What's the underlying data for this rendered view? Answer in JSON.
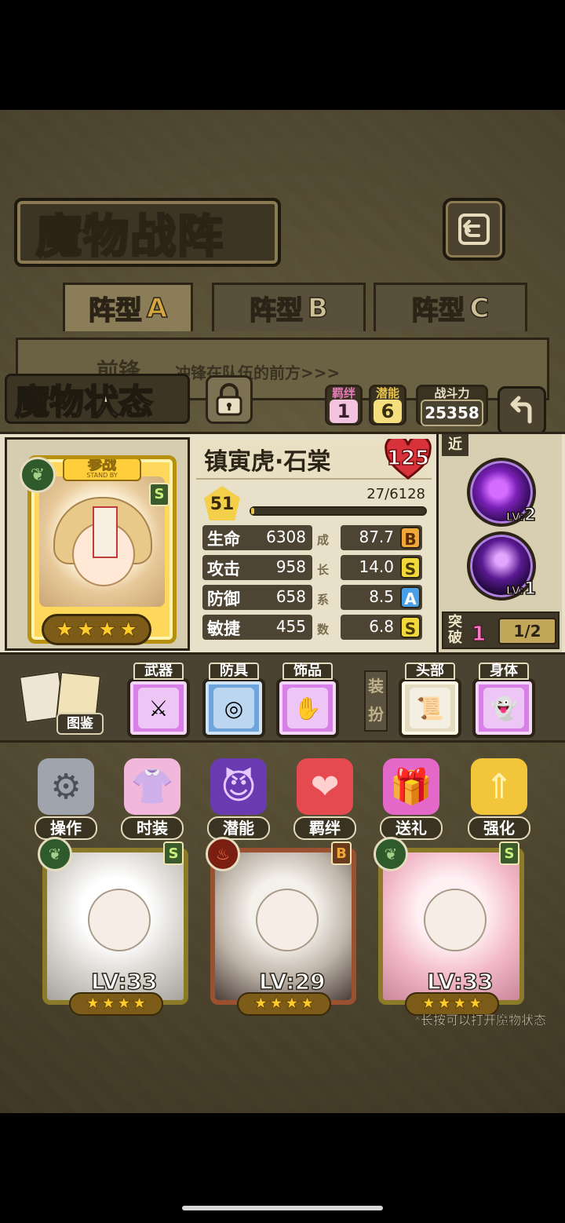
{
  "header": {
    "title": "魔物战阵"
  },
  "tabs": [
    {
      "label": "阵型",
      "letter": "A",
      "active": true
    },
    {
      "label": "阵型",
      "letter": "B",
      "active": false
    },
    {
      "label": "阵型",
      "letter": "C",
      "active": false
    }
  ],
  "front": {
    "label": "前锋",
    "desc": "冲锋在队伍的前方>>>"
  },
  "status": {
    "title": "魔物状态",
    "bond_label": "羁绊",
    "bond_value": "1",
    "potential_label": "潜能",
    "potential_value": "6",
    "power_label": "战斗力",
    "power_value": "25358"
  },
  "character": {
    "standby_cn": "参战",
    "standby_en": "STAND BY",
    "rank": "S",
    "name": "镇寅虎·石棠",
    "heart_value": "125",
    "level": "51",
    "exp_text": "27/6128",
    "exp_fraction": 0.0044,
    "stars": 4,
    "growth_chars": [
      "成",
      "长",
      "系",
      "数"
    ],
    "stats": [
      {
        "label": "生命",
        "value": "6308",
        "growth": "87.7",
        "grade": "B"
      },
      {
        "label": "攻击",
        "value": "958",
        "growth": "14.0",
        "grade": "S"
      },
      {
        "label": "防御",
        "value": "658",
        "growth": "8.5",
        "grade": "A"
      },
      {
        "label": "敏捷",
        "value": "455",
        "growth": "6.8",
        "grade": "S"
      }
    ]
  },
  "skills": {
    "range": "近",
    "items": [
      {
        "lv_label": "LV:",
        "lv": "2"
      },
      {
        "lv_label": "LV:",
        "lv": "1"
      }
    ],
    "breakthrough_label": "突破",
    "breakthrough_value": "1",
    "breakthrough_progress": "1/2"
  },
  "equipment": {
    "codex_label": "图鉴",
    "weapon_label": "武器",
    "armor_label": "防具",
    "accessory_label": "饰品",
    "dress_label": "装扮",
    "head_label": "头部",
    "body_label": "身体"
  },
  "actions": [
    {
      "label": "操作",
      "icon": "gear-icon"
    },
    {
      "label": "时装",
      "icon": "outfit-icon"
    },
    {
      "label": "潜能",
      "icon": "demon-icon"
    },
    {
      "label": "羁绊",
      "icon": "hearts-icon"
    },
    {
      "label": "送礼",
      "icon": "gift-icon"
    },
    {
      "label": "强化",
      "icon": "arrows-up-icon"
    }
  ],
  "team": [
    {
      "lv": "LV:33",
      "rank": "S",
      "element": "leaf",
      "stars": 4
    },
    {
      "lv": "LV:29",
      "rank": "B",
      "element": "fire",
      "stars": 4
    },
    {
      "lv": "LV:33",
      "rank": "S",
      "element": "leaf",
      "stars": 4
    }
  ],
  "hint": "*长按可以打开魔物状态",
  "colors": {
    "accent_gold": "#ffcc2b",
    "grade_S": "#f1d83b",
    "grade_A": "#4aa0e6",
    "grade_B": "#f0a73a",
    "skill_purple": "#7b21b8"
  }
}
